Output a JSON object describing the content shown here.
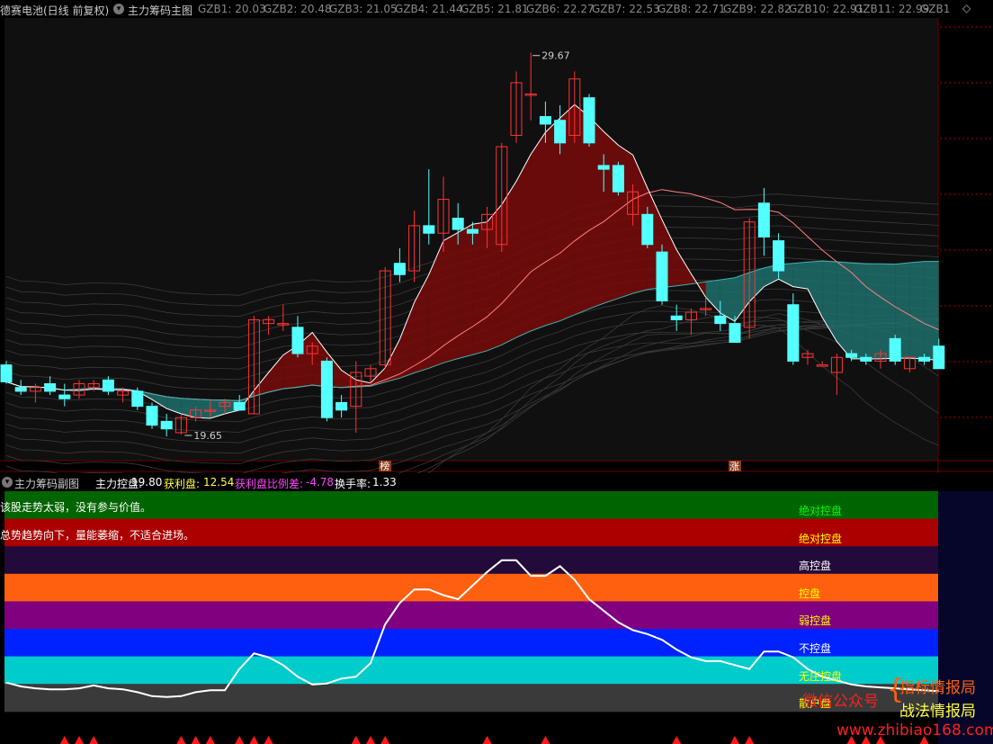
{
  "main_panel": {
    "title": "德赛电池(日线 前复权)",
    "indicator": "主力筹码主图",
    "gzb": [
      {
        "label": "GZB1: 20.03"
      },
      {
        "label": "GZB2: 20.48"
      },
      {
        "label": "GZB3: 21.05"
      },
      {
        "label": "GZB4: 21.44"
      },
      {
        "label": "GZB5: 21.81"
      },
      {
        "label": "GZB6: 22.27"
      },
      {
        "label": "GZB7: 22.53"
      },
      {
        "label": "GZB8: 22.71"
      },
      {
        "label": "GZB9: 22.82"
      },
      {
        "label": "GZB10: 22.91"
      },
      {
        "label": "GZB11: 22.99"
      },
      {
        "label": "GZB1"
      }
    ],
    "high_label": "29.67",
    "low_label": "19.65",
    "badge_bang": "榜",
    "badge_zhang": "涨"
  },
  "sub_panel": {
    "name": "主力筹码副图",
    "control_label": "主力控盘:",
    "control_value": "19.80",
    "profit_label": "获利盘:",
    "profit_value": "12.54",
    "profit_diff_label": "获利盘比例差:",
    "profit_diff_value": "-4.78",
    "turnover_label": "换手率:",
    "turnover_value": "1.33",
    "message1": "该股走势太弱，没有参与价值。",
    "message2": "总势趋势向下，量能萎缩，不适合进场。",
    "bands": [
      {
        "label": "绝对控盘",
        "color": "#006400",
        "text_color": "#00ff00"
      },
      {
        "label": "绝对控盘",
        "color": "#aa0000",
        "text_color": "#ffff00"
      },
      {
        "label": "高控盘",
        "color": "#220a3a",
        "text_color": "#ffffff"
      },
      {
        "label": "控盘",
        "color": "#ff6010",
        "text_color": "#ffff00"
      },
      {
        "label": "弱控盘",
        "color": "#800080",
        "text_color": "#ffff00"
      },
      {
        "label": "不控盘",
        "color": "#0022ff",
        "text_color": "#ffffff"
      },
      {
        "label": "无庄控盘",
        "color": "#00cccc",
        "text_color": "#ffff00"
      },
      {
        "label": "散户盘",
        "color": "#3a3a3a",
        "text_color": "#ffff00"
      }
    ]
  },
  "watermark": {
    "line1": "指标情报局",
    "line2": "战法情报局",
    "wechat": "微信公众号",
    "url": "www.zhibiao168.com"
  },
  "colors": {
    "up": "#ff3333",
    "down": "#54ffff",
    "teal_fill": "#1f7a78",
    "red_fill": "#8b0000",
    "title_purple": "#ff60ff",
    "profit_yellow": "#ffff44",
    "diff_magenta": "#ff44ff"
  },
  "chart_data": [
    {
      "type": "candlestick",
      "title": "主力筹码主图",
      "ylim": [
        19,
        30.5
      ],
      "candles": [
        {
          "o": 21.4,
          "h": 21.5,
          "l": 20.9,
          "c": 20.95
        },
        {
          "o": 20.8,
          "h": 21.0,
          "l": 20.6,
          "c": 20.7
        },
        {
          "o": 20.7,
          "h": 20.9,
          "l": 20.4,
          "c": 20.8
        },
        {
          "o": 20.9,
          "h": 21.1,
          "l": 20.6,
          "c": 20.7
        },
        {
          "o": 20.6,
          "h": 20.9,
          "l": 20.3,
          "c": 20.5
        },
        {
          "o": 20.6,
          "h": 21.0,
          "l": 20.5,
          "c": 20.9
        },
        {
          "o": 20.8,
          "h": 21.0,
          "l": 20.7,
          "c": 20.9
        },
        {
          "o": 21.0,
          "h": 21.1,
          "l": 20.6,
          "c": 20.7
        },
        {
          "o": 20.6,
          "h": 20.8,
          "l": 20.4,
          "c": 20.7
        },
        {
          "o": 20.7,
          "h": 20.8,
          "l": 20.2,
          "c": 20.3
        },
        {
          "o": 20.3,
          "h": 20.4,
          "l": 19.7,
          "c": 19.8
        },
        {
          "o": 19.9,
          "h": 20.1,
          "l": 19.5,
          "c": 19.7
        },
        {
          "o": 19.6,
          "h": 20.1,
          "l": 19.55,
          "c": 20.0
        },
        {
          "o": 20.0,
          "h": 20.3,
          "l": 19.9,
          "c": 20.2
        },
        {
          "o": 20.2,
          "h": 20.5,
          "l": 20.0,
          "c": 20.2
        },
        {
          "o": 20.3,
          "h": 20.5,
          "l": 20.1,
          "c": 20.4
        },
        {
          "o": 20.4,
          "h": 20.6,
          "l": 20.2,
          "c": 20.2
        },
        {
          "o": 20.1,
          "h": 22.7,
          "l": 20.1,
          "c": 22.6
        },
        {
          "o": 22.5,
          "h": 22.7,
          "l": 22.2,
          "c": 22.6
        },
        {
          "o": 22.5,
          "h": 23.0,
          "l": 22.3,
          "c": 22.5
        },
        {
          "o": 22.4,
          "h": 22.7,
          "l": 21.6,
          "c": 21.7
        },
        {
          "o": 21.7,
          "h": 22.0,
          "l": 21.4,
          "c": 21.9
        },
        {
          "o": 21.5,
          "h": 21.6,
          "l": 19.9,
          "c": 20.0
        },
        {
          "o": 20.4,
          "h": 20.6,
          "l": 20.0,
          "c": 20.2
        },
        {
          "o": 20.3,
          "h": 21.5,
          "l": 19.6,
          "c": 21.2
        },
        {
          "o": 21.1,
          "h": 21.4,
          "l": 20.9,
          "c": 21.3
        },
        {
          "o": 21.4,
          "h": 24.0,
          "l": 21.3,
          "c": 23.9
        },
        {
          "o": 24.1,
          "h": 24.5,
          "l": 23.6,
          "c": 23.8
        },
        {
          "o": 23.9,
          "h": 25.5,
          "l": 23.6,
          "c": 25.1
        },
        {
          "o": 25.1,
          "h": 26.6,
          "l": 24.6,
          "c": 24.9
        },
        {
          "o": 24.9,
          "h": 26.4,
          "l": 24.4,
          "c": 25.8
        },
        {
          "o": 25.3,
          "h": 25.7,
          "l": 24.6,
          "c": 25.0
        },
        {
          "o": 25.0,
          "h": 25.2,
          "l": 24.6,
          "c": 24.9
        },
        {
          "o": 25.0,
          "h": 25.6,
          "l": 24.5,
          "c": 25.4
        },
        {
          "o": 24.6,
          "h": 27.3,
          "l": 24.4,
          "c": 27.2
        },
        {
          "o": 27.5,
          "h": 29.2,
          "l": 27.3,
          "c": 28.9
        },
        {
          "o": 28.6,
          "h": 29.7,
          "l": 27.9,
          "c": 28.6
        },
        {
          "o": 28.0,
          "h": 28.4,
          "l": 27.3,
          "c": 27.8
        },
        {
          "o": 27.9,
          "h": 28.3,
          "l": 27.0,
          "c": 27.3
        },
        {
          "o": 27.5,
          "h": 29.2,
          "l": 27.3,
          "c": 29.0
        },
        {
          "o": 28.5,
          "h": 28.6,
          "l": 27.2,
          "c": 27.3
        },
        {
          "o": 26.7,
          "h": 27.0,
          "l": 26.0,
          "c": 26.6
        },
        {
          "o": 26.7,
          "h": 26.8,
          "l": 25.9,
          "c": 26.0
        },
        {
          "o": 25.4,
          "h": 26.2,
          "l": 25.1,
          "c": 26.0
        },
        {
          "o": 25.4,
          "h": 25.6,
          "l": 24.5,
          "c": 24.6
        },
        {
          "o": 24.4,
          "h": 24.6,
          "l": 23.0,
          "c": 23.1
        },
        {
          "o": 22.7,
          "h": 23.0,
          "l": 22.3,
          "c": 22.6
        },
        {
          "o": 22.6,
          "h": 22.9,
          "l": 22.2,
          "c": 22.8
        },
        {
          "o": 22.9,
          "h": 23.2,
          "l": 22.7,
          "c": 22.9
        },
        {
          "o": 22.7,
          "h": 23.1,
          "l": 22.3,
          "c": 22.5
        },
        {
          "o": 22.5,
          "h": 22.7,
          "l": 22.0,
          "c": 22.0
        },
        {
          "o": 22.4,
          "h": 25.3,
          "l": 22.1,
          "c": 25.2
        },
        {
          "o": 25.7,
          "h": 26.1,
          "l": 24.3,
          "c": 24.8
        },
        {
          "o": 24.7,
          "h": 24.9,
          "l": 23.7,
          "c": 23.9
        },
        {
          "o": 23.0,
          "h": 23.3,
          "l": 21.4,
          "c": 21.5
        },
        {
          "o": 21.6,
          "h": 21.8,
          "l": 21.4,
          "c": 21.7
        },
        {
          "o": 21.4,
          "h": 21.5,
          "l": 21.4,
          "c": 21.4
        },
        {
          "o": 21.2,
          "h": 21.7,
          "l": 20.6,
          "c": 21.6
        },
        {
          "o": 21.7,
          "h": 21.8,
          "l": 21.5,
          "c": 21.6
        },
        {
          "o": 21.6,
          "h": 21.7,
          "l": 21.4,
          "c": 21.5
        },
        {
          "o": 21.5,
          "h": 21.8,
          "l": 21.3,
          "c": 21.7
        },
        {
          "o": 22.1,
          "h": 22.2,
          "l": 21.4,
          "c": 21.5
        },
        {
          "o": 21.3,
          "h": 21.6,
          "l": 21.2,
          "c": 21.6
        },
        {
          "o": 21.6,
          "h": 21.7,
          "l": 21.4,
          "c": 21.5
        },
        {
          "o": 21.9,
          "h": 22.1,
          "l": 21.3,
          "c": 21.3
        }
      ]
    },
    {
      "type": "line",
      "title": "主力筹码副图",
      "ylim": [
        0,
        100
      ],
      "bands": [
        0,
        12.5,
        25,
        37.5,
        50,
        62.5,
        75,
        87.5,
        100
      ],
      "values": [
        15,
        13,
        12,
        11.5,
        11.5,
        12,
        13.5,
        12,
        11.5,
        10,
        8,
        7.5,
        8,
        10,
        11,
        11,
        22,
        30,
        28,
        24,
        18,
        14,
        14.5,
        17,
        18,
        25,
        45,
        56,
        63,
        63,
        60,
        58,
        65,
        72,
        78,
        78,
        70,
        70,
        75,
        68,
        58,
        52,
        46,
        42,
        40,
        37,
        32,
        28,
        26,
        26,
        24,
        22,
        31,
        31,
        28,
        22,
        18,
        16,
        14,
        13,
        12.5,
        12,
        11.5,
        11,
        10.5
      ]
    }
  ]
}
